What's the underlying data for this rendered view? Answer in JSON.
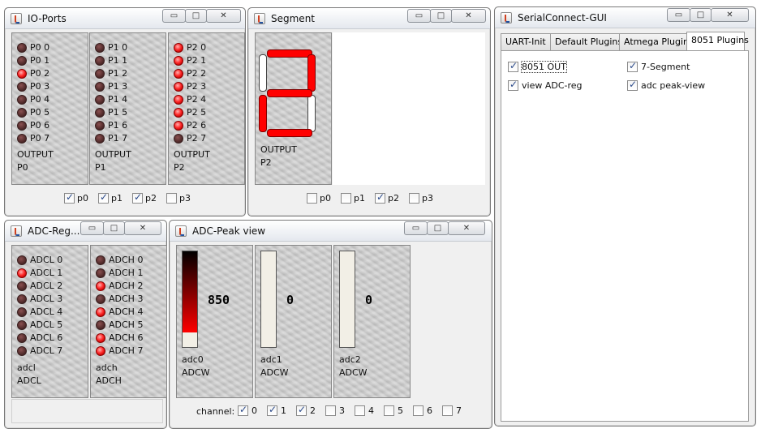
{
  "io_ports": {
    "title": "IO-Ports",
    "controls": {
      "minimize": "▭",
      "maximize": "□",
      "close": "✕"
    },
    "panels": [
      {
        "leds": [
          {
            "label": "P0 0",
            "on": false
          },
          {
            "label": "P0 1",
            "on": false
          },
          {
            "label": "P0 2",
            "on": true
          },
          {
            "label": "P0 3",
            "on": false
          },
          {
            "label": "P0 4",
            "on": false
          },
          {
            "label": "P0 5",
            "on": false
          },
          {
            "label": "P0 6",
            "on": false
          },
          {
            "label": "P0 7",
            "on": false
          }
        ],
        "mode": "OUTPUT",
        "port": "P0"
      },
      {
        "leds": [
          {
            "label": "P1 0",
            "on": false
          },
          {
            "label": "P1 1",
            "on": false
          },
          {
            "label": "P1 2",
            "on": false
          },
          {
            "label": "P1 3",
            "on": false
          },
          {
            "label": "P1 4",
            "on": false
          },
          {
            "label": "P1 5",
            "on": false
          },
          {
            "label": "P1 6",
            "on": false
          },
          {
            "label": "P1 7",
            "on": false
          }
        ],
        "mode": "OUTPUT",
        "port": "P1"
      },
      {
        "leds": [
          {
            "label": "P2 0",
            "on": true
          },
          {
            "label": "P2 1",
            "on": true
          },
          {
            "label": "P2 2",
            "on": true
          },
          {
            "label": "P2 3",
            "on": true
          },
          {
            "label": "P2 4",
            "on": true
          },
          {
            "label": "P2 5",
            "on": true
          },
          {
            "label": "P2 6",
            "on": true
          },
          {
            "label": "P2 7",
            "on": false
          }
        ],
        "mode": "OUTPUT",
        "port": "P2"
      }
    ],
    "checkboxes": [
      {
        "label": "p0",
        "checked": true
      },
      {
        "label": "p1",
        "checked": true
      },
      {
        "label": "p2",
        "checked": true
      },
      {
        "label": "p3",
        "checked": false
      }
    ]
  },
  "segment": {
    "title": "Segment",
    "controls": {
      "minimize": "▭",
      "maximize": "□",
      "close": "✕"
    },
    "segments": {
      "a": true,
      "b": true,
      "c": false,
      "d": true,
      "e": true,
      "f": false,
      "g": true
    },
    "mode": "OUTPUT",
    "port": "P2",
    "checkboxes": [
      {
        "label": "p0",
        "checked": false
      },
      {
        "label": "p1",
        "checked": false
      },
      {
        "label": "p2",
        "checked": true
      },
      {
        "label": "p3",
        "checked": false
      }
    ]
  },
  "serial": {
    "title": "SerialConnect-GUI",
    "controls": {
      "minimize": "▭",
      "maximize": "□",
      "close": "✕"
    },
    "tabs": [
      {
        "label": "UART-Init",
        "active": false
      },
      {
        "label": "Default Plugins",
        "active": false
      },
      {
        "label": "Atmega Plugins",
        "active": false
      },
      {
        "label": "8051 Plugins",
        "active": true
      }
    ],
    "plugins": [
      {
        "label": "8051 OUT",
        "checked": true
      },
      {
        "label": "7-Segment",
        "checked": true
      },
      {
        "label": "view ADC-reg",
        "checked": true
      },
      {
        "label": "adc peak-view",
        "checked": true
      }
    ]
  },
  "adc_reg": {
    "title": "ADC-Reg...",
    "controls": {
      "minimize": "▭",
      "maximize": "□",
      "close": "✕"
    },
    "panels": [
      {
        "leds": [
          {
            "label": "ADCL 0",
            "on": false
          },
          {
            "label": "ADCL 1",
            "on": true
          },
          {
            "label": "ADCL 2",
            "on": false
          },
          {
            "label": "ADCL 3",
            "on": false
          },
          {
            "label": "ADCL 4",
            "on": false
          },
          {
            "label": "ADCL 5",
            "on": false
          },
          {
            "label": "ADCL 6",
            "on": false
          },
          {
            "label": "ADCL 7",
            "on": false
          }
        ],
        "name": "adcl",
        "reg": "ADCL"
      },
      {
        "leds": [
          {
            "label": "ADCH 0",
            "on": false
          },
          {
            "label": "ADCH 1",
            "on": false
          },
          {
            "label": "ADCH 2",
            "on": true
          },
          {
            "label": "ADCH 3",
            "on": false
          },
          {
            "label": "ADCH 4",
            "on": true
          },
          {
            "label": "ADCH 5",
            "on": false
          },
          {
            "label": "ADCH 6",
            "on": true
          },
          {
            "label": "ADCH 7",
            "on": true
          }
        ],
        "name": "adch",
        "reg": "ADCH"
      }
    ]
  },
  "adc_peak": {
    "title": "ADC-Peak view",
    "controls": {
      "minimize": "▭",
      "maximize": "□",
      "close": "✕"
    },
    "channels": [
      {
        "name": "adc0",
        "reg": "ADCW",
        "value": "850",
        "level": 0.83
      },
      {
        "name": "adc1",
        "reg": "ADCW",
        "value": "0",
        "level": 0
      },
      {
        "name": "adc2",
        "reg": "ADCW",
        "value": "0",
        "level": 0
      }
    ],
    "channel_label": "channel:",
    "channel_checks": [
      {
        "label": "0",
        "checked": true
      },
      {
        "label": "1",
        "checked": true
      },
      {
        "label": "2",
        "checked": true
      },
      {
        "label": "3",
        "checked": false
      },
      {
        "label": "4",
        "checked": false
      },
      {
        "label": "5",
        "checked": false
      },
      {
        "label": "6",
        "checked": false
      },
      {
        "label": "7",
        "checked": false
      }
    ]
  }
}
